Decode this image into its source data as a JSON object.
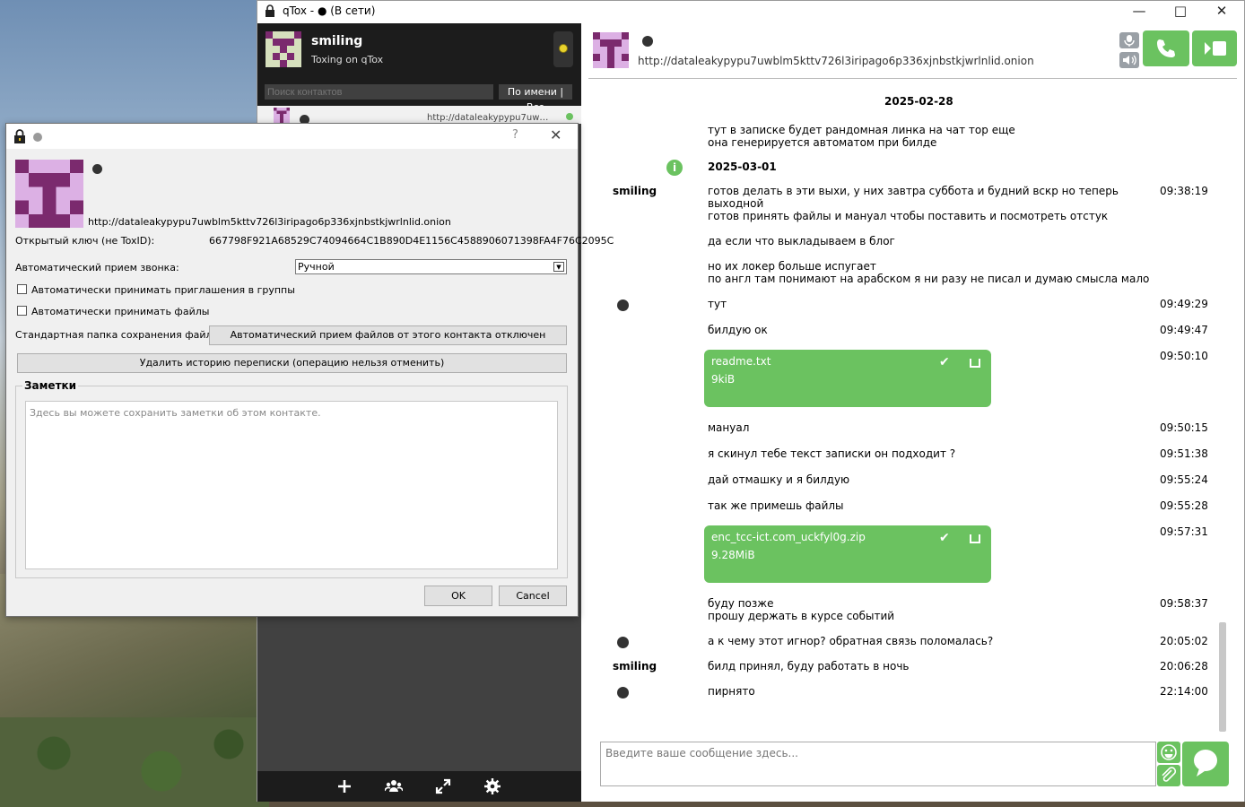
{
  "window": {
    "title": "qTox - ● (В сети)"
  },
  "profile": {
    "name": "smiling",
    "status_text": "Toxing on qTox"
  },
  "search": {
    "placeholder": "Поиск контактов",
    "sort_label": "По имени | Все"
  },
  "contact_list": [
    {
      "address": "http://dataleakypypu7uwblm5..."
    }
  ],
  "chat": {
    "address": "http://dataleakypypu7uwblm5kttv726l3iripago6p336xjnbstkjwrlnlid.onion",
    "input_placeholder": "Введите ваше сообщение здесь...",
    "dates": [
      "2025-02-28",
      "2025-03-01"
    ],
    "messages": [
      {
        "author": "",
        "text": "тут в записке будет рандомная линка на чат тор еще\nона генерируется автоматом при билде",
        "time": ""
      },
      {
        "author": "smiling",
        "text": "готов делать в эти выхи, у них завтра суббота и будний вскр но теперь\nвыходной\nготов принять файлы и мануал чтобы поставить и посмотреть отстук\n\nда если что выкладываем в блог\n\nно их локер больше испугает\nпо англ там понимают на арабском я ни разу не писал и думаю смысла мало",
        "time": "09:38:19"
      },
      {
        "author": "",
        "text": "тут",
        "time": "09:49:29"
      },
      {
        "author": "",
        "text": "билдую ок",
        "time": "09:49:47"
      },
      {
        "author": "",
        "file": "readme.txt",
        "size": "9kiB",
        "time": "09:50:10"
      },
      {
        "author": "",
        "text": "мануал",
        "time": "09:50:15"
      },
      {
        "author": "",
        "text": "я скинул тебе текст записки он подходит ?",
        "time": "09:51:38"
      },
      {
        "author": "",
        "text": "дай отмашку и я билдую",
        "time": "09:55:24"
      },
      {
        "author": "",
        "text": "так же примешь файлы",
        "time": "09:55:28"
      },
      {
        "author": "",
        "file": "enc_tcc-ict.com_uckfyl0g.zip",
        "size": "9.28MiB",
        "time": "09:57:31"
      },
      {
        "author": "",
        "text": "буду позже\nпрошу держать в курсе событий",
        "time": "09:58:37"
      },
      {
        "author": "",
        "text": "а к чему этот игнор? обратная связь поломалась?",
        "time": "20:05:02"
      },
      {
        "author": "smiling",
        "text": "билд принял, буду работать в ночь",
        "time": "20:06:28"
      },
      {
        "author": "",
        "text": "пирнято",
        "time": "22:14:00"
      }
    ]
  },
  "dialog": {
    "address": "http://dataleakypypu7uwblm5kttv726l3iripago6p336xjnbstkjwrlnlid.onion",
    "public_key_label": "Открытый ключ (не ToxID):",
    "public_key": "667798F921A68529C74094664C1B890D4E1156C4588906071398FA4F76C2095C",
    "auto_answer_label": "Автоматический прием звонка:",
    "auto_answer_value": "Ручной",
    "auto_group_label": "Автоматически принимать приглашения в группы",
    "auto_files_label": "Автоматически принимать файлы",
    "folder_label": "Стандартная папка сохранения файлов:",
    "folder_button": "Автоматический прием файлов от этого контакта отключен",
    "remove_history_button": "Удалить историю переписки (операцию нельзя отменить)",
    "notes_title": "Заметки",
    "notes_placeholder": "Здесь вы можете сохранить заметки об этом контакте.",
    "ok": "OK",
    "cancel": "Cancel",
    "help": "?"
  },
  "colors": {
    "accent": "#6bc260",
    "avatar": "#7b2a6e",
    "avatar_light": "#dcb0e4"
  }
}
